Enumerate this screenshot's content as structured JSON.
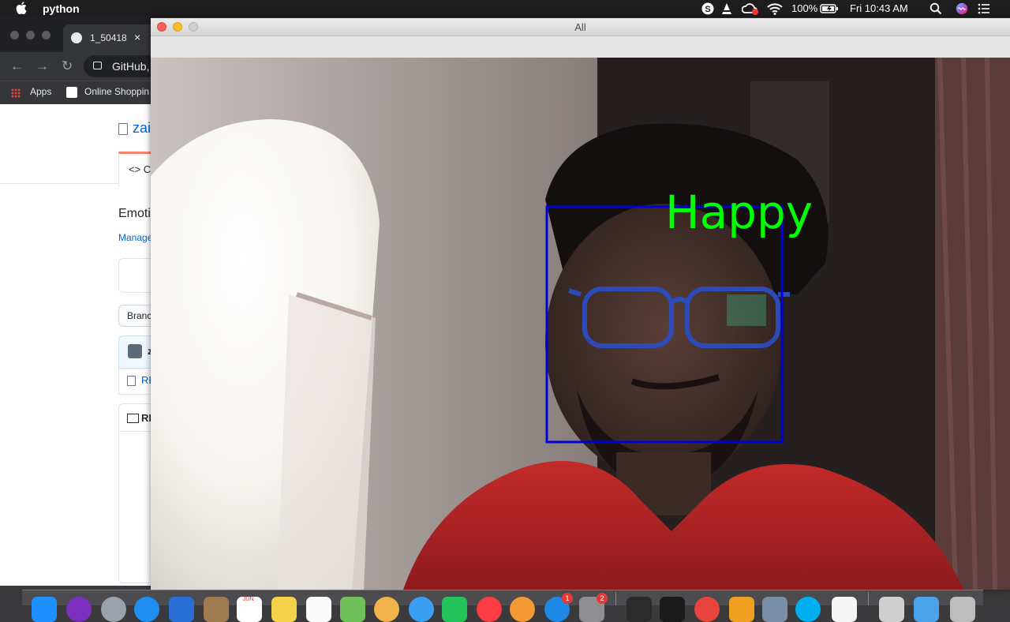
{
  "menubar": {
    "app_name": "python",
    "battery": "100%",
    "clock": "Fri 10:43 AM",
    "icons": [
      "apple-icon",
      "skype-icon",
      "vlc-icon",
      "creative-cloud-icon",
      "wifi-icon",
      "battery-icon",
      "search-icon",
      "siri-icon",
      "control-center-icon"
    ]
  },
  "chrome": {
    "tab_title": "1_50418",
    "tab_close": "×",
    "nav": {
      "back": "←",
      "forward": "→",
      "reload": "↻"
    },
    "url": "GitHub,",
    "bookmarks": [
      {
        "label": "Apps"
      },
      {
        "label": "Online Shoppin"
      }
    ],
    "github": {
      "repo_name": "zai",
      "code_tab": "<> C",
      "description": "Emoti",
      "manage_link": "Manage",
      "branch_label": "Branc",
      "commit_user": "z",
      "file_name": "RE",
      "readme_label": "RE"
    }
  },
  "opencv_window": {
    "title": "All",
    "detection_label": "Happy",
    "box_color": "#0000d6",
    "label_color": "#00ff00"
  },
  "dock": {
    "badges": [
      "1",
      "2"
    ],
    "calendar_month": "JUN"
  }
}
